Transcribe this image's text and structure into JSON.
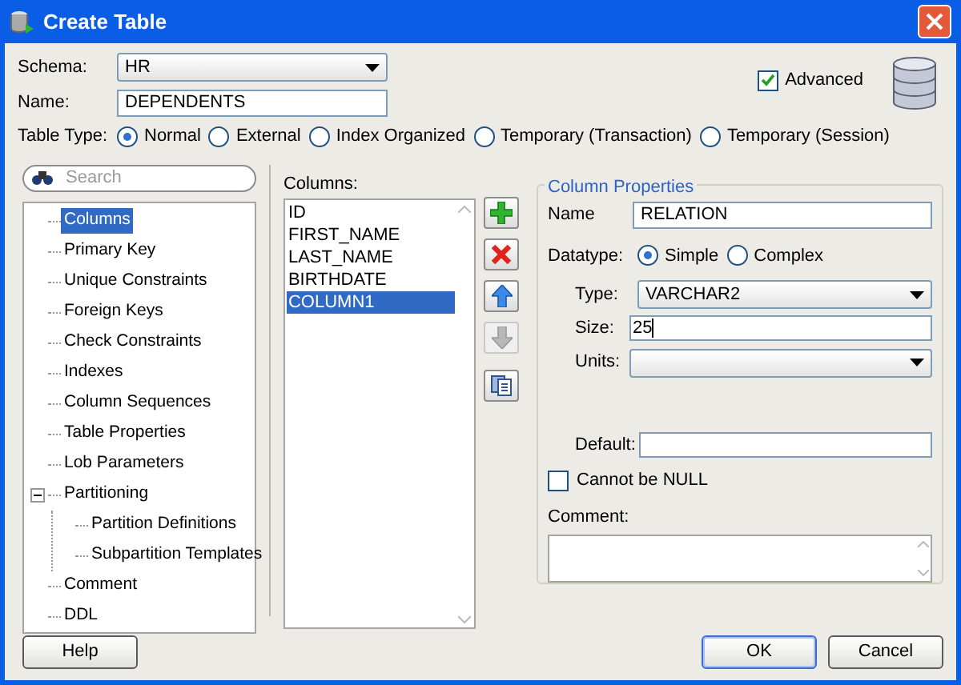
{
  "window": {
    "title": "Create Table"
  },
  "schema": {
    "label": "Schema:",
    "value": "HR"
  },
  "name": {
    "label": "Name:",
    "value": "DEPENDENTS"
  },
  "table_type": {
    "label": "Table Type:",
    "options": [
      {
        "label": "Normal",
        "selected": true
      },
      {
        "label": "External",
        "selected": false
      },
      {
        "label": "Index Organized",
        "selected": false
      },
      {
        "label": "Temporary (Transaction)",
        "selected": false
      },
      {
        "label": "Temporary (Session)",
        "selected": false
      }
    ]
  },
  "advanced": {
    "label": "Advanced",
    "checked": true
  },
  "search": {
    "placeholder": "Search"
  },
  "nav": [
    {
      "label": "Columns",
      "selected": true
    },
    {
      "label": "Primary Key",
      "selected": false
    },
    {
      "label": "Unique Constraints",
      "selected": false
    },
    {
      "label": "Foreign Keys",
      "selected": false
    },
    {
      "label": "Check Constraints",
      "selected": false
    },
    {
      "label": "Indexes",
      "selected": false
    },
    {
      "label": "Column Sequences",
      "selected": false
    },
    {
      "label": "Table Properties",
      "selected": false
    },
    {
      "label": "Lob Parameters",
      "selected": false
    },
    {
      "label": "Partitioning",
      "selected": false,
      "expanded": true,
      "children": [
        {
          "label": "Partition Definitions",
          "selected": false
        },
        {
          "label": "Subpartition Templates",
          "selected": false
        }
      ]
    },
    {
      "label": "Comment",
      "selected": false
    },
    {
      "label": "DDL",
      "selected": false
    }
  ],
  "columns": {
    "label": "Columns:",
    "items": [
      {
        "name": "ID",
        "selected": false
      },
      {
        "name": "FIRST_NAME",
        "selected": false
      },
      {
        "name": "LAST_NAME",
        "selected": false
      },
      {
        "name": "BIRTHDATE",
        "selected": false
      },
      {
        "name": "COLUMN1",
        "selected": true
      }
    ]
  },
  "column_buttons": [
    {
      "kind": "add",
      "disabled": false
    },
    {
      "kind": "delete",
      "disabled": false
    },
    {
      "kind": "up",
      "disabled": false
    },
    {
      "kind": "down",
      "disabled": true
    },
    {
      "kind": "copy",
      "disabled": false
    }
  ],
  "properties": {
    "title": "Column Properties",
    "name": {
      "label": "Name",
      "value": "RELATION"
    },
    "datatype": {
      "label": "Datatype:",
      "options": [
        {
          "label": "Simple",
          "selected": true
        },
        {
          "label": "Complex",
          "selected": false
        }
      ]
    },
    "type": {
      "label": "Type:",
      "value": "VARCHAR2"
    },
    "size": {
      "label": "Size:",
      "value": "25"
    },
    "units": {
      "label": "Units:"
    },
    "default": {
      "label": "Default:"
    },
    "not_null": {
      "label": "Cannot be NULL",
      "checked": false
    },
    "comment": {
      "label": "Comment:"
    }
  },
  "buttons": [
    {
      "label": "Help",
      "focused": false
    },
    {
      "label": "OK",
      "focused": true
    },
    {
      "label": "Cancel",
      "focused": false
    }
  ]
}
